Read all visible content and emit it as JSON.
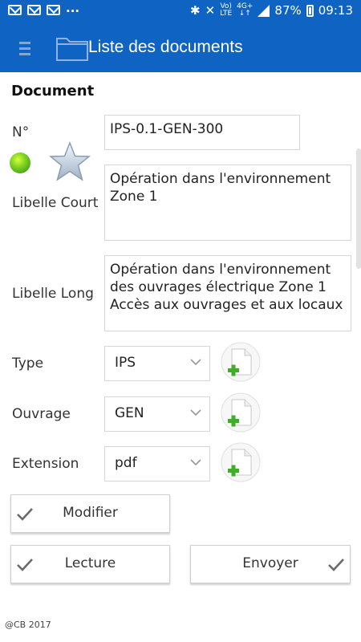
{
  "status_bar": {
    "ellipsis": "...",
    "volte_top": "Vo)",
    "volte_bottom": "LTE",
    "network_top": "4G+",
    "network_bottom": "↓↑",
    "battery": "87%",
    "time": "09:13"
  },
  "app_bar": {
    "title": "Liste des documents",
    "brand_color": "#0f63c2"
  },
  "form": {
    "section_title": "Document",
    "numero_label": "N°",
    "numero_value": "IPS-0.1-GEN-300",
    "libelle_court_label": "Libelle Court",
    "libelle_court_value": "Opération dans l'environnement Zone 1",
    "libelle_long_label": "Libelle Long",
    "libelle_long_value": "Opération dans l'environnement des ouvrages électrique Zone 1 Accès aux ouvrages et aux locaux",
    "type_label": "Type",
    "type_value": "IPS",
    "ouvrage_label": "Ouvrage",
    "ouvrage_value": "GEN",
    "extension_label": "Extension",
    "extension_value": "pdf",
    "status_color": "#7ed321"
  },
  "buttons": {
    "modifier": "Modifier",
    "lecture": "Lecture",
    "envoyer": "Envoyer"
  },
  "footer": "@CB 2017"
}
